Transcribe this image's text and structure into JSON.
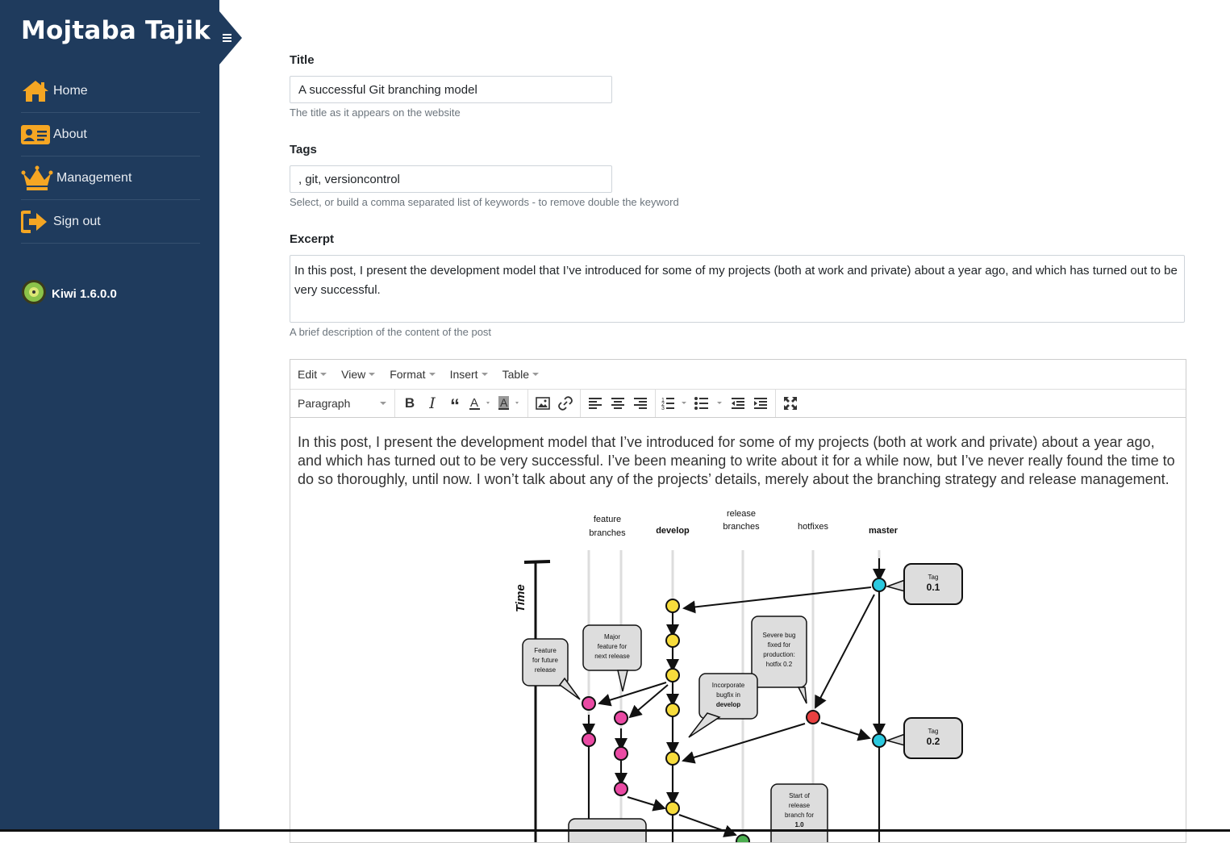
{
  "sidebar": {
    "brand": "Mojtaba Tajik",
    "items": [
      {
        "label": "Home",
        "icon": "home-icon"
      },
      {
        "label": "About",
        "icon": "id-card-icon"
      },
      {
        "label": "Management",
        "icon": "crown-icon"
      },
      {
        "label": "Sign out",
        "icon": "sign-out-icon"
      }
    ],
    "version": "Kiwi 1.6.0.0",
    "accent": "#f5a623",
    "background": "#1f3b5d"
  },
  "form": {
    "title": {
      "label": "Title",
      "value": "A successful Git branching model",
      "help": "The title as it appears on the website"
    },
    "tags": {
      "label": "Tags",
      "value": ", git, versioncontrol",
      "help": "Select, or build a comma separated list of keywords - to remove double the keyword"
    },
    "excerpt": {
      "label": "Excerpt",
      "value": "In this post, I present the development model that I’ve introduced for some of my projects (both at work and private) about a year ago, and which has turned out to be very successful.",
      "help": "A brief description of the content of the post"
    }
  },
  "editor": {
    "menus": [
      "Edit",
      "View",
      "Format",
      "Insert",
      "Table"
    ],
    "format_select": "Paragraph",
    "toolbar_icons": [
      "bold-icon",
      "italic-icon",
      "blockquote-icon",
      "text-color-icon",
      "background-color-icon",
      "image-icon",
      "link-icon",
      "align-left-icon",
      "align-center-icon",
      "align-right-icon",
      "numbered-list-icon",
      "bullet-list-icon",
      "outdent-icon",
      "indent-icon",
      "fullscreen-icon"
    ],
    "content": "In this post, I present the development model that I’ve introduced for some of my projects (both at work and private) about a year ago, and which has turned out to be very successful. I’ve been meaning to write about it for a while now, but I’ve never really found the time to do so thoroughly, until now. I won’t talk about any of the projects’ details, merely about the branching strategy and release management."
  },
  "diagram": {
    "columns": {
      "feature_1": "feature",
      "feature_2": "branches",
      "develop": "develop",
      "release_1": "release",
      "release_2": "branches",
      "hotfixes": "hotfixes",
      "master": "master"
    },
    "time_label": "Time",
    "tag1": {
      "line1": "Tag",
      "line2": "0.1"
    },
    "tag2": {
      "line1": "Tag",
      "line2": "0.2"
    },
    "callouts": {
      "feature_future": [
        "Feature",
        "for future",
        "release"
      ],
      "major_feature": [
        "Major",
        "feature for",
        "next release"
      ],
      "severe_bug": [
        "Severe bug",
        "fixed for",
        "production:",
        "hotfix 0.2"
      ],
      "incorporate": [
        "Incorporate",
        "bugfix in",
        "develop"
      ],
      "start_release": [
        "Start of",
        "release",
        "branch for",
        "1.0"
      ]
    },
    "colors": {
      "develop": "#f7dc3c",
      "feature": "#ea4aa4",
      "hotfix": "#e84040",
      "master": "#2bc9df",
      "release": "#4caf50"
    }
  }
}
